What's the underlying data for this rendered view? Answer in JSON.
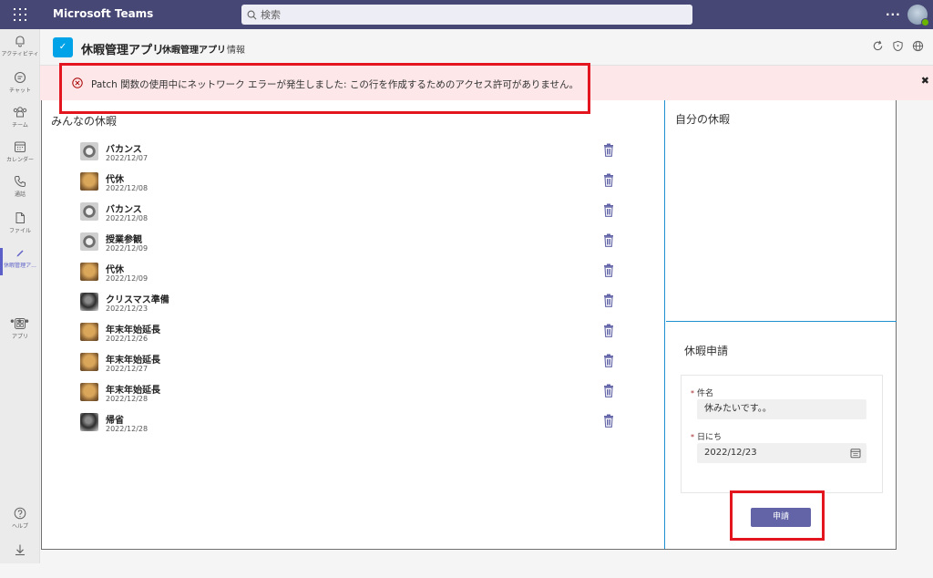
{
  "topbar": {
    "app_title": "Microsoft Teams",
    "search_placeholder": "検索",
    "more": "..."
  },
  "rail": {
    "items": [
      {
        "label": "アクティビティ",
        "icon": "bell-icon"
      },
      {
        "label": "チャット",
        "icon": "chat-icon"
      },
      {
        "label": "チーム",
        "icon": "teams-icon"
      },
      {
        "label": "カレンダー",
        "icon": "calendar-icon"
      },
      {
        "label": "通話",
        "icon": "phone-icon"
      },
      {
        "label": "ファイル",
        "icon": "file-icon"
      },
      {
        "label": "休暇管理ア...",
        "icon": "pencil-icon"
      },
      {
        "label": "アプリ",
        "icon": "apps-icon"
      },
      {
        "label": "ヘルプ",
        "icon": "help-icon"
      }
    ],
    "more": "•••"
  },
  "header": {
    "app_name": "休暇管理アプリ",
    "tabs": [
      {
        "label": "休暇管理アプリ"
      },
      {
        "label": "情報"
      }
    ]
  },
  "error": {
    "message": "Patch 関数の使用中にネットワーク エラーが発生しました: この行を作成するためのアクセス許可がありません。",
    "close": "✖"
  },
  "left_panel": {
    "title": "みんなの休暇",
    "items": [
      {
        "title": "バカンス",
        "date": "2022/12/07",
        "avatar": "camera"
      },
      {
        "title": "代休",
        "date": "2022/12/08",
        "avatar": "dog"
      },
      {
        "title": "バカンス",
        "date": "2022/12/08",
        "avatar": "camera"
      },
      {
        "title": "授業参観",
        "date": "2022/12/09",
        "avatar": "camera"
      },
      {
        "title": "代休",
        "date": "2022/12/09",
        "avatar": "dog"
      },
      {
        "title": "クリスマス準備",
        "date": "2022/12/23",
        "avatar": "dark"
      },
      {
        "title": "年末年始延長",
        "date": "2022/12/26",
        "avatar": "dog"
      },
      {
        "title": "年末年始延長",
        "date": "2022/12/27",
        "avatar": "dog"
      },
      {
        "title": "年末年始延長",
        "date": "2022/12/28",
        "avatar": "dog"
      },
      {
        "title": "帰省",
        "date": "2022/12/28",
        "avatar": "dark"
      }
    ]
  },
  "right_panel": {
    "my_title": "自分の休暇",
    "form_title": "休暇申請",
    "required_mark": "*",
    "fields": [
      {
        "label": "件名",
        "value": "休みたいです。。"
      },
      {
        "label": "日にち",
        "value": "2022/12/23"
      }
    ],
    "submit_label": "申請"
  },
  "colors": {
    "accent": "#6264a7",
    "teams_bar": "#464775",
    "error_bg": "#fde7e9",
    "highlight": "#e3151f"
  }
}
